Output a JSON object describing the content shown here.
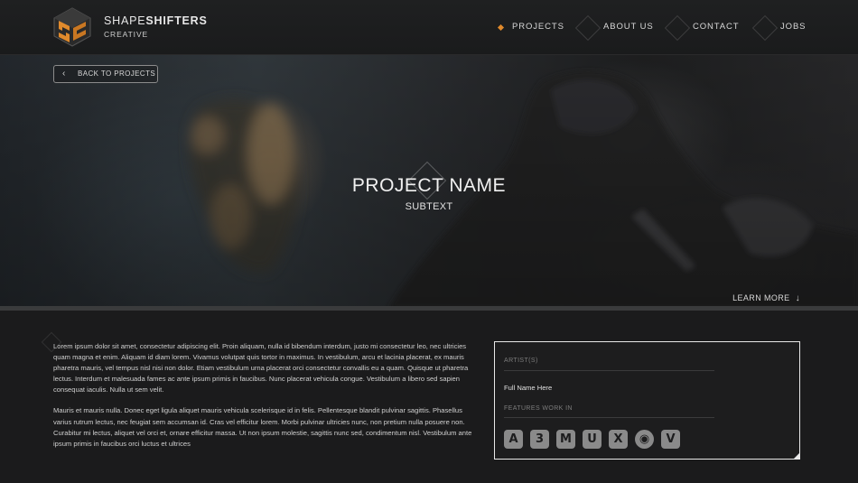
{
  "header": {
    "brand_bold": "SHAPESHIFTERS",
    "brand_prefix": "SHAPE",
    "brand_suffix": "SHIFTERS",
    "brand_sub": "CREATIVE",
    "nav": [
      {
        "label": "PROJECTS",
        "active": true
      },
      {
        "label": "ABOUT US",
        "active": false
      },
      {
        "label": "CONTACT",
        "active": false
      },
      {
        "label": "JOBS",
        "active": false
      }
    ],
    "accent_color": "#e08a2c"
  },
  "hero": {
    "back_label": "BACK TO PROJECTS",
    "title": "PROJECT NAME",
    "subtitle": "SUBTEXT",
    "learn_more": "LEARN MORE"
  },
  "content": {
    "paragraphs": [
      "Lorem ipsum dolor sit amet, consectetur adipiscing elit. Proin aliquam, nulla id bibendum interdum, justo mi consectetur leo, nec ultricies quam magna et enim. Aliquam id diam lorem. Vivamus volutpat quis tortor in maximus. In vestibulum, arcu et lacinia placerat, ex mauris pharetra mauris, vel tempus nisl nisi non dolor. Etiam vestibulum urna placerat orci consectetur convallis eu a quam. Quisque ut pharetra lectus. Interdum et malesuada fames ac ante ipsum primis in faucibus. Nunc placerat vehicula congue. Vestibulum a libero sed sapien consequat iaculis. Nulla ut sem velit.",
      "Mauris et mauris nulla. Donec eget ligula aliquet mauris vehicula scelerisque id in felis. Pellentesque blandit pulvinar sagittis. Phasellus varius rutrum lectus, nec feugiat sem accumsan id. Cras vel efficitur lorem. Morbi pulvinar ultricies nunc, non pretium nulla posuere non. Curabitur mi lectus, aliquet vel orci et, ornare efficitur massa. Ut non ipsum molestie, sagittis nunc sed, condimentum nisl. Vestibulum ante ipsum primis in faucibus orci luctus et ultrices"
    ]
  },
  "info": {
    "artist_label": "ARTIST(S)",
    "artist_name": "Full Name Here",
    "features_label": "FEATURES WORK IN",
    "software": [
      {
        "icon": "adobe-animate-icon",
        "glyph": "A"
      },
      {
        "icon": "3ds-max-icon",
        "glyph": "3"
      },
      {
        "icon": "maya-icon",
        "glyph": "M"
      },
      {
        "icon": "unreal-engine-icon",
        "glyph": "U"
      },
      {
        "icon": "xsi-icon",
        "glyph": "X"
      },
      {
        "icon": "blender-icon",
        "glyph": "◉"
      },
      {
        "icon": "vray-icon",
        "glyph": "V"
      }
    ]
  }
}
